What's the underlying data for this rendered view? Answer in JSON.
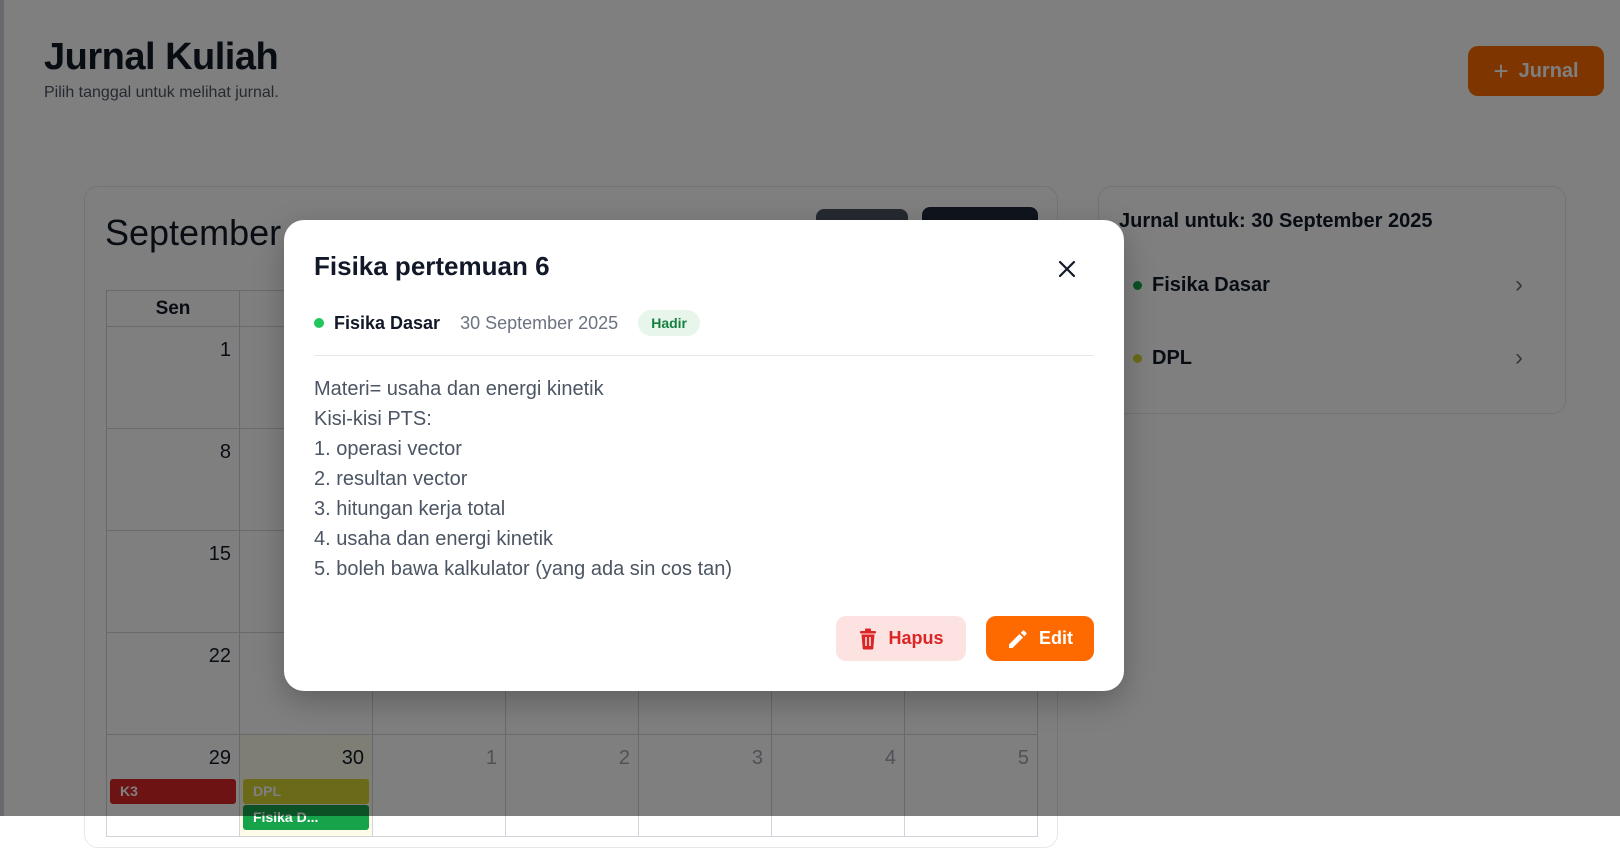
{
  "header": {
    "title": "Jurnal Kuliah",
    "subtitle": "Pilih tanggal untuk melihat jurnal.",
    "add_button_label": "Jurnal",
    "add_icon": "plus-icon"
  },
  "calendar": {
    "month_label": "September",
    "weekday_labels": [
      "Sen",
      "",
      "",
      "",
      "",
      "",
      ""
    ],
    "weeks": [
      [
        {
          "day": "1"
        },
        {
          "day": ""
        },
        {
          "day": ""
        },
        {
          "day": ""
        },
        {
          "day": ""
        },
        {
          "day": ""
        },
        {
          "day": ""
        }
      ],
      [
        {
          "day": "8"
        },
        {
          "day": ""
        },
        {
          "day": ""
        },
        {
          "day": ""
        },
        {
          "day": ""
        },
        {
          "day": ""
        },
        {
          "day": ""
        }
      ],
      [
        {
          "day": "15"
        },
        {
          "day": ""
        },
        {
          "day": ""
        },
        {
          "day": ""
        },
        {
          "day": ""
        },
        {
          "day": ""
        },
        {
          "day": ""
        }
      ],
      [
        {
          "day": "22"
        },
        {
          "day": ""
        },
        {
          "day": ""
        },
        {
          "day": ""
        },
        {
          "day": ""
        },
        {
          "day": ""
        },
        {
          "day": ""
        }
      ],
      [
        {
          "day": "29",
          "events": [
            {
              "label": "K3",
              "color": "#dc2626"
            }
          ]
        },
        {
          "day": "30",
          "today": true,
          "events": [
            {
              "label": "DPL",
              "color": "#d4d432"
            },
            {
              "label": "Fisika D...",
              "color": "#16a34a"
            }
          ]
        },
        {
          "day": "1",
          "other": true
        },
        {
          "day": "2",
          "other": true
        },
        {
          "day": "3",
          "other": true
        },
        {
          "day": "4",
          "other": true
        },
        {
          "day": "5",
          "other": true
        }
      ]
    ]
  },
  "side_panel": {
    "title": "Jurnal untuk: 30 September 2025",
    "items": [
      {
        "name": "Fisika Dasar",
        "color": "#16a34a"
      },
      {
        "name": "DPL",
        "color": "#d4d432"
      }
    ]
  },
  "modal": {
    "title": "Fisika pertemuan 6",
    "course": "Fisika Dasar",
    "course_color": "#22c55e",
    "date": "30 September 2025",
    "status": "Hadir",
    "content_lines": [
      "Materi= usaha dan energi kinetik",
      "Kisi-kisi PTS:",
      "1. operasi vector",
      "2. resultan vector",
      "3. hitungan kerja total",
      "4. usaha dan energi kinetik",
      "5. boleh bawa kalkulator (yang ada sin cos tan)"
    ],
    "delete_label": "Hapus",
    "edit_label": "Edit",
    "delete_icon": "trash-icon",
    "edit_icon": "pencil-icon",
    "close_icon": "close-icon"
  },
  "colors": {
    "accent": "#ff6a00",
    "danger": "#dc2626",
    "danger_bg": "#fde2e2",
    "success": "#15803d"
  }
}
